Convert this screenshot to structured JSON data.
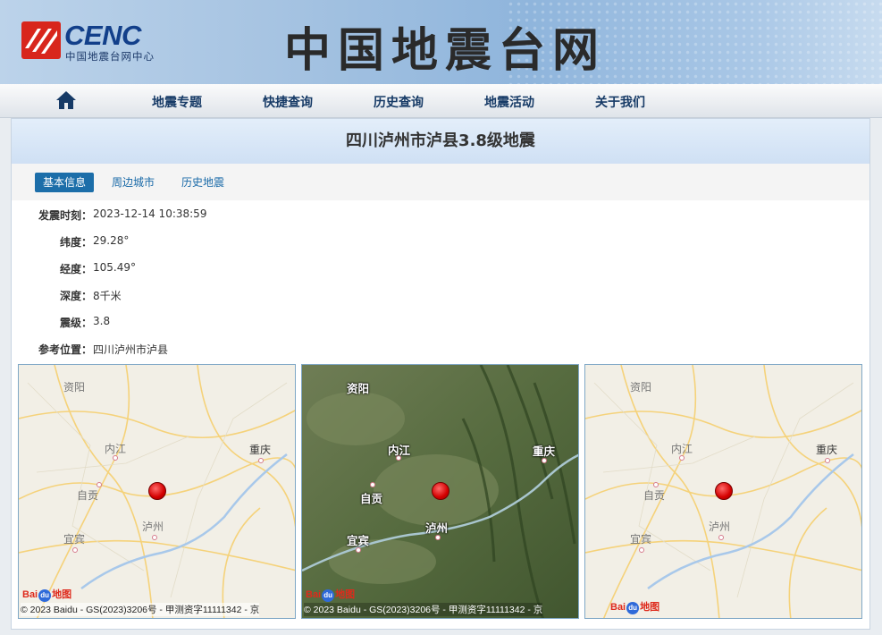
{
  "header": {
    "logo_text": "CENC",
    "logo_sub": "中国地震台网中心",
    "site_title": "中国地震台网"
  },
  "nav": {
    "home_icon": "home-icon",
    "items": [
      "地震专题",
      "快捷查询",
      "历史查询",
      "地震活动",
      "关于我们"
    ]
  },
  "event": {
    "title": "四川泸州市泸县3.8级地震"
  },
  "tabs": [
    "基本信息",
    "周边城市",
    "历史地震"
  ],
  "active_tab": "基本信息",
  "info": [
    {
      "label": "发震时刻：",
      "value": "2023-12-14 10:38:59"
    },
    {
      "label": "纬度：",
      "value": "29.28°"
    },
    {
      "label": "经度：",
      "value": "105.49°"
    },
    {
      "label": "深度：",
      "value": "8千米"
    },
    {
      "label": "震级：",
      "value": "3.8"
    },
    {
      "label": "参考位置：",
      "value": "四川泸州市泸县"
    }
  ],
  "maps": [
    {
      "type": "road",
      "cities": [
        "资阳",
        "内江",
        "重庆",
        "自贡",
        "泸州",
        "宜宾"
      ],
      "baidu_logo": "Bai 地图",
      "copyright": "© 2023 Baidu - GS(2023)3206号 - 甲测资字11111342 - 京"
    },
    {
      "type": "satellite",
      "cities": [
        "资阳",
        "内江",
        "重庆",
        "自贡",
        "泸州",
        "宜宾"
      ],
      "baidu_logo": "Bai 地图",
      "copyright": "© 2023 Baidu - GS(2023)3206号 - 甲测资字11111342 - 京"
    },
    {
      "type": "road",
      "cities": [
        "资阳",
        "内江",
        "重庆",
        "自贡",
        "泸州",
        "宜宾"
      ],
      "baidu_logo": "Bai 地图"
    }
  ],
  "colors": {
    "accent": "#1c6ea9",
    "quake_marker": "#d40000",
    "nav_text": "#163a66"
  }
}
